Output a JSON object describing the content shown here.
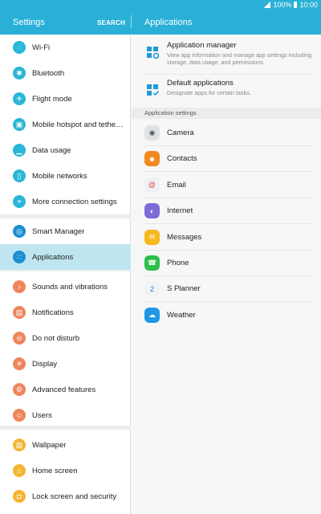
{
  "status": {
    "battery": "100%",
    "time": "10:00"
  },
  "header": {
    "title": "Settings",
    "search": "SEARCH",
    "right_title": "Applications"
  },
  "sidebar": {
    "items": [
      {
        "label": "Wi-Fi",
        "icon": "wifi-icon",
        "color": "#29b6d8"
      },
      {
        "label": "Bluetooth",
        "icon": "bluetooth-icon",
        "color": "#29b6d8"
      },
      {
        "label": "Flight mode",
        "icon": "airplane-icon",
        "color": "#29b6d8"
      },
      {
        "label": "Mobile hotspot and tetheri...",
        "icon": "hotspot-icon",
        "color": "#29b6d8"
      },
      {
        "label": "Data usage",
        "icon": "data-usage-icon",
        "color": "#29b6d8"
      },
      {
        "label": "Mobile networks",
        "icon": "mobile-networks-icon",
        "color": "#29b6d8"
      },
      {
        "label": "More connection settings",
        "icon": "more-connections-icon",
        "color": "#29b6d8"
      },
      {
        "label": "Smart Manager",
        "icon": "smart-manager-icon",
        "color": "#1b8fd1"
      },
      {
        "label": "Applications",
        "icon": "applications-icon",
        "color": "#1b8fd1"
      },
      {
        "label": "Sounds and vibrations",
        "icon": "sound-icon",
        "color": "#f0845a"
      },
      {
        "label": "Notifications",
        "icon": "notifications-icon",
        "color": "#f0845a"
      },
      {
        "label": "Do not disturb",
        "icon": "do-not-disturb-icon",
        "color": "#f0845a"
      },
      {
        "label": "Display",
        "icon": "display-icon",
        "color": "#f0845a"
      },
      {
        "label": "Advanced features",
        "icon": "advanced-features-icon",
        "color": "#f0845a"
      },
      {
        "label": "Users",
        "icon": "users-icon",
        "color": "#f0845a"
      },
      {
        "label": "Wallpaper",
        "icon": "wallpaper-icon",
        "color": "#f5b431"
      },
      {
        "label": "Home screen",
        "icon": "home-icon",
        "color": "#f5b431"
      },
      {
        "label": "Lock screen and security",
        "icon": "lock-icon",
        "color": "#f5b431"
      }
    ]
  },
  "main": {
    "app_manager": {
      "title": "Application manager",
      "subtitle": "View app information and manage app settings including storage, data usage, and permissions."
    },
    "default_apps": {
      "title": "Default applications",
      "subtitle": "Designate apps for certain tasks."
    },
    "section_header": "Application settings",
    "apps": [
      {
        "label": "Camera",
        "icon": "camera-icon",
        "color": "#dfe3e6"
      },
      {
        "label": "Contacts",
        "icon": "contacts-icon",
        "color": "#f08a1f"
      },
      {
        "label": "Email",
        "icon": "email-icon",
        "color": "#eef0f2"
      },
      {
        "label": "Internet",
        "icon": "internet-icon",
        "color": "#7e6bd9"
      },
      {
        "label": "Messages",
        "icon": "messages-icon",
        "color": "#f5b81e"
      },
      {
        "label": "Phone",
        "icon": "phone-icon",
        "color": "#2cbf4a"
      },
      {
        "label": "S Planner",
        "icon": "calendar-icon",
        "color": "#f1f3f4"
      },
      {
        "label": "Weather",
        "icon": "weather-icon",
        "color": "#1e98e6"
      }
    ]
  }
}
